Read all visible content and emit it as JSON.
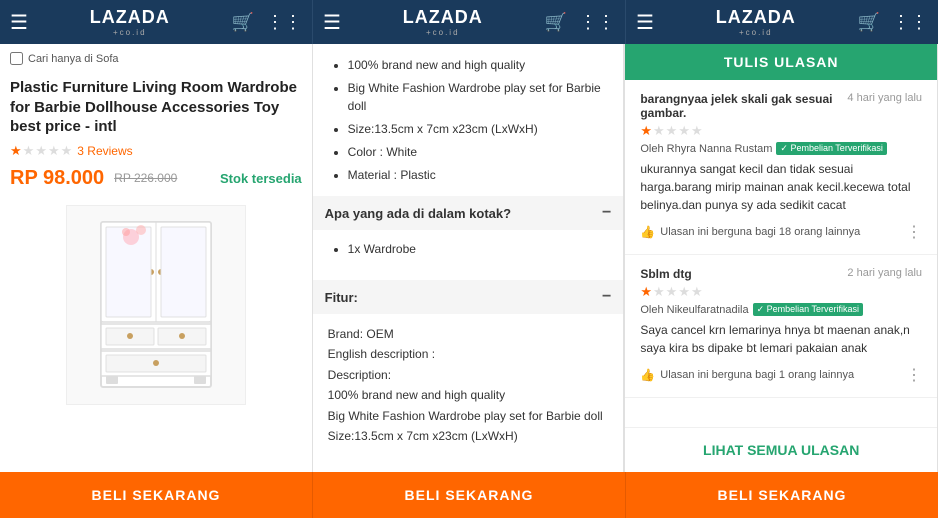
{
  "header": {
    "logo": "LAZADA",
    "logo_sub": "+co.id",
    "sections": [
      {
        "logo": "LAZADA",
        "sub": "+co.id"
      },
      {
        "logo": "LAZADA",
        "sub": "+co.id"
      },
      {
        "logo": "LAZADA",
        "sub": "+co.id"
      }
    ]
  },
  "panel1": {
    "search_checkbox_label": "Cari hanya di Sofa",
    "product_title": "Plastic Furniture Living Room Wardrobe for Barbie Dollhouse Accessories Toy best price - intl",
    "rating": {
      "filled": 1,
      "empty": 4
    },
    "review_count": "3 Reviews",
    "price_main": "RP 98.000",
    "price_orig": "RP 226.000",
    "stock": "Stok tersedia"
  },
  "panel2": {
    "bullets": [
      "100% brand new and high quality",
      "Big White Fashion Wardrobe play set for Barbie doll",
      "Size:13.5cm x 7cm x23cm (LxWxH)",
      "Color : White",
      "Material : Plastic"
    ],
    "box_header": "Apa yang ada di dalam kotak?",
    "box_content": "1x Wardrobe",
    "features_header": "Fitur:",
    "brand_label": "Brand: OEM",
    "english_desc_label": "English description :",
    "description_label": "Description:",
    "desc_line1": "100% brand new and high quality",
    "desc_line2": "Big White Fashion Wardrobe play set for Barbie doll",
    "desc_line3": "Size:13.5cm x 7cm x23cm (LxWxH)"
  },
  "panel3": {
    "write_review_label": "TULIS ULASAN",
    "reviews": [
      {
        "title": "barangnyaa jelek skali gak sesuai gambar.",
        "time": "4 hari yang lalu",
        "rating": {
          "filled": 1,
          "empty": 4
        },
        "author": "Oleh Rhyra Nanna Rustam",
        "verified": "Pembelian Terverifikasi",
        "text": "ukurannya sangat kecil dan tidak sesuai harga.barang mirip mainan anak kecil.kecewa total belinya.dan punya sy ada sedikit cacat",
        "helpful": "Ulasan ini berguna bagi 18 orang lainnya"
      },
      {
        "title": "Sblm dtg",
        "time": "2 hari yang lalu",
        "rating": {
          "filled": 1,
          "empty": 4
        },
        "author": "Oleh Nikeulfaratnadila",
        "verified": "Pembelian Terverifikasi",
        "text": "Saya cancel krn lemarinya hnya bt maenan anak,n saya kira bs dipake bt lemari pakaian anak",
        "helpful": "Ulasan ini berguna bagi 1 orang lainnya"
      }
    ],
    "see_all": "LIHAT SEMUA ULASAN"
  },
  "bottom": {
    "buy_label": "BELI SEKARANG"
  }
}
